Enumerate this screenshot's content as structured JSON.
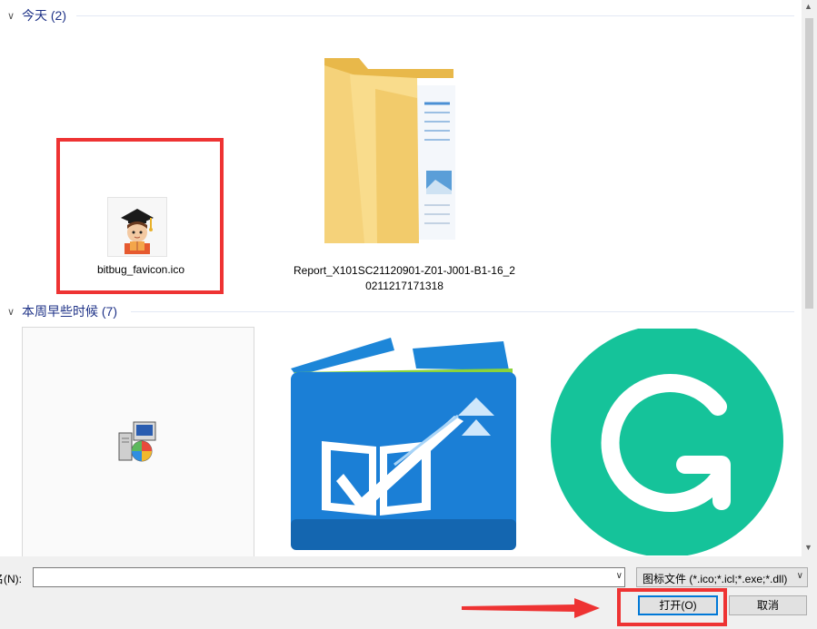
{
  "groups": [
    {
      "label": "今天 (2)"
    },
    {
      "label": "本周早些时候 (7)"
    }
  ],
  "files_today": [
    {
      "name": "bitbug_favicon.ico",
      "icon": "graduate-avatar-icon"
    },
    {
      "name_line1": "Report_X101SC21120901-Z01-J001-B1-16_2",
      "name_line2": "0211217171318",
      "icon": "folder-icon"
    }
  ],
  "files_week": [
    {
      "icon": "installer-package-icon"
    },
    {
      "icon": "blue-box-check-icon"
    },
    {
      "icon": "grammarly-g-icon"
    }
  ],
  "bottom": {
    "filename_label": "名(N):",
    "filename_value": "",
    "filter_value": "图标文件 (*.ico;*.icl;*.exe;*.dll)",
    "open_label": "打开(O)",
    "cancel_label": "取消"
  },
  "colors": {
    "highlight": "#ee3333",
    "group_header": "#1e3287",
    "primary_border": "#0078d7",
    "grammarly_green": "#15c39a"
  }
}
